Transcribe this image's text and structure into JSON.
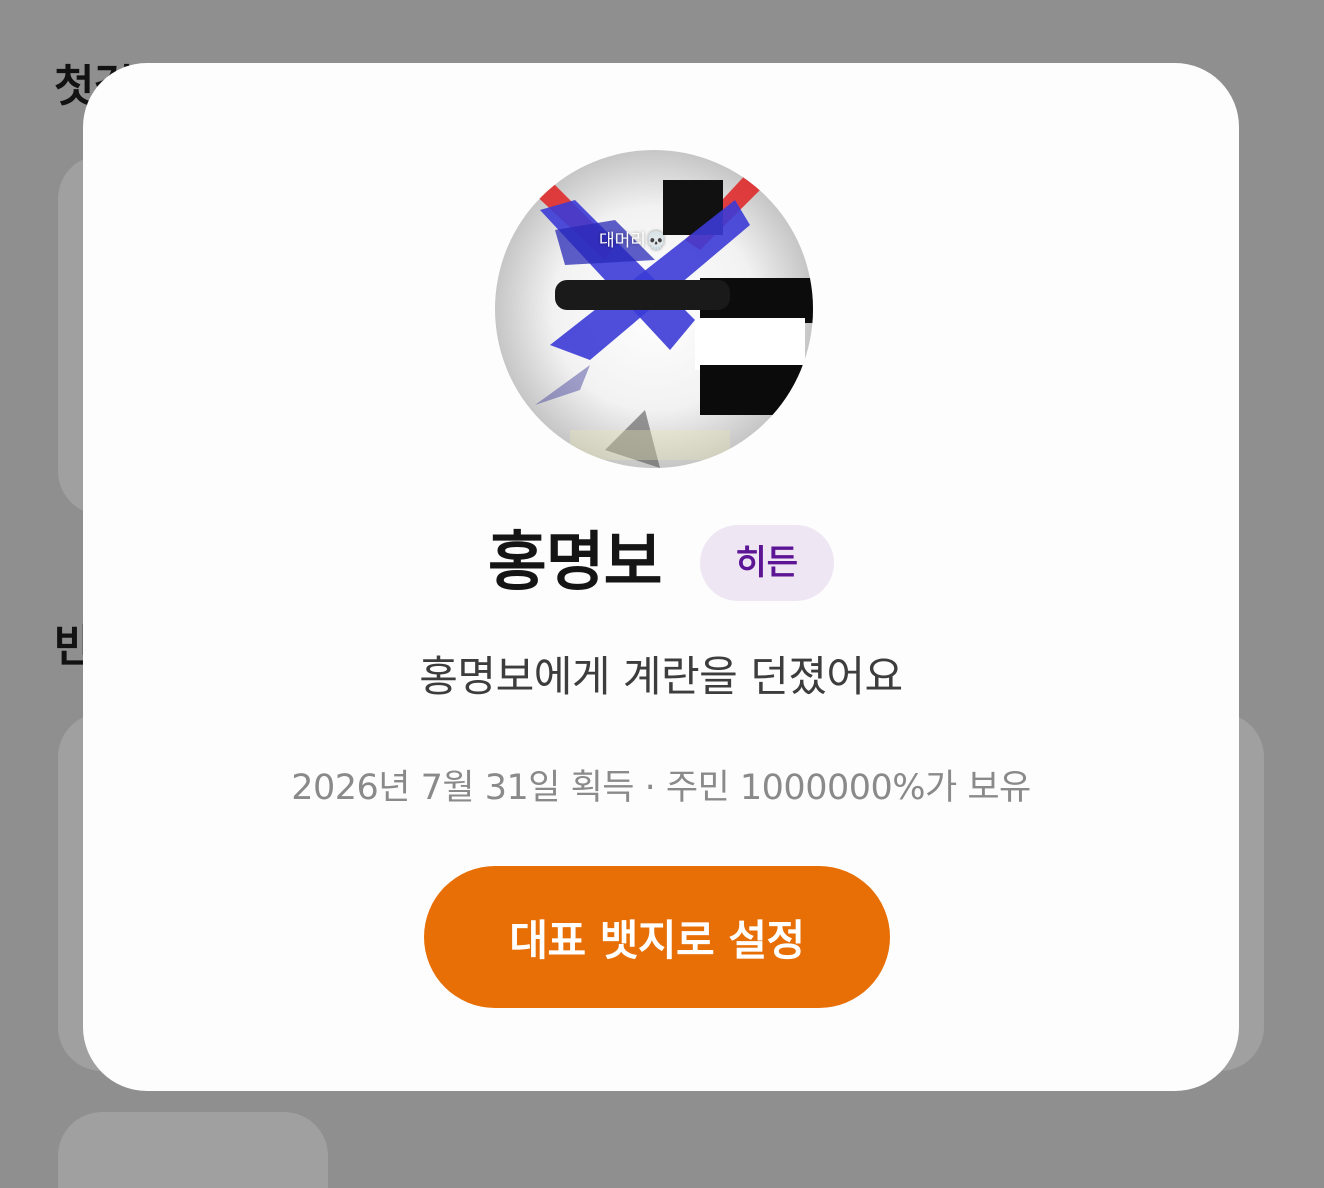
{
  "background": {
    "heading_1": "첫걸음",
    "heading_2": "반"
  },
  "badge_modal": {
    "image_caption": "대머리💀",
    "name": "홍명보",
    "tier": "히든",
    "description": "홍명보에게 계란을 던졌어요",
    "meta": "2026년 7월 31일 획득 · 주민 1000000%가 보유",
    "set_primary_button": "대표 뱃지로 설정"
  },
  "colors": {
    "overlay_background": "#8f8f8f",
    "modal_background": "#fdfdfd",
    "tier_badge_background": "#efe6f4",
    "tier_badge_text": "#5c1594",
    "button_background": "#e86f05",
    "button_text": "#ffffff"
  }
}
